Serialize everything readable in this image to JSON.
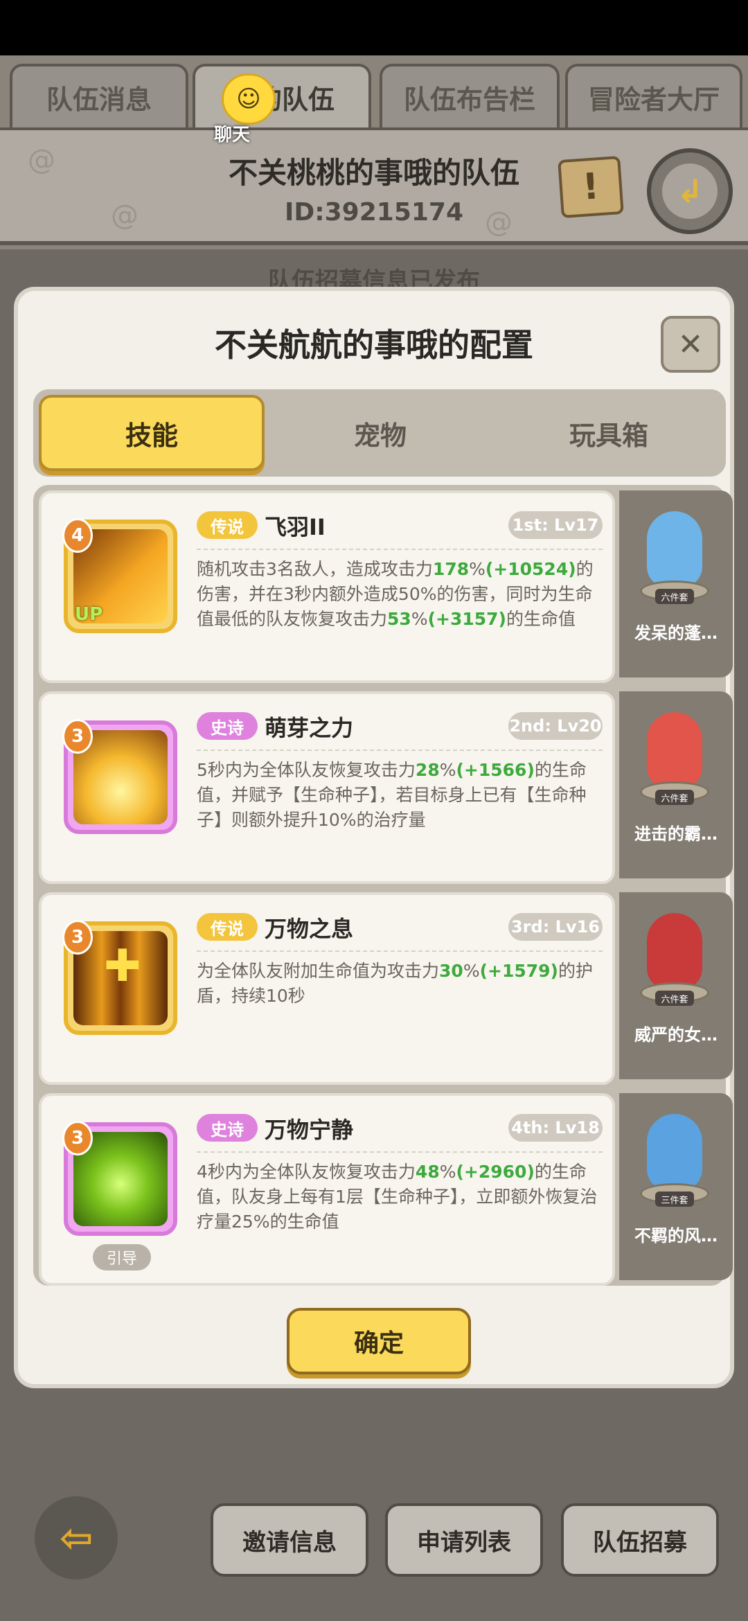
{
  "tabs": [
    "队伍消息",
    "我的队伍",
    "队伍布告栏",
    "冒险者大厅"
  ],
  "chat": {
    "label": "聊天"
  },
  "header": {
    "team_name": "不关桃桃的事哦的队伍",
    "team_id": "ID:39215174"
  },
  "background_notice": "队伍招募信息已发布",
  "modal": {
    "title": "不关航航的事哦的配置",
    "tabs": [
      "技能",
      "宠物",
      "玩具箱"
    ],
    "skills": [
      {
        "badge_level": "4",
        "rarity": "传说",
        "name": "飞羽II",
        "slot": "1st: Lv17",
        "up": "UP",
        "desc_parts": [
          "随机攻击3名敌人，造成攻击力",
          "178",
          "%",
          "(+10524)",
          "的伤害，并在3秒内额外造成50%的伤害，同时为生命值最低的队友恢复攻击力",
          "53",
          "%",
          "(+3157)",
          "的生命值"
        ]
      },
      {
        "badge_level": "3",
        "rarity": "史诗",
        "name": "萌芽之力",
        "slot": "2nd: Lv20",
        "desc_parts": [
          "5秒内为全体队友恢复攻击力",
          "28",
          "%",
          "(+1566)",
          "的生命值，并赋予【生命种子】，若目标身上已有【生命种子】则额外提升10%的治疗量"
        ]
      },
      {
        "badge_level": "3",
        "rarity": "传说",
        "name": "万物之息",
        "slot": "3rd: Lv16",
        "desc_parts": [
          "为全体队友附加生命值为攻击力",
          "30",
          "%",
          "(+1579)",
          "的护盾，持续10秒"
        ]
      },
      {
        "badge_level": "3",
        "rarity": "史诗",
        "name": "万物宁静",
        "slot": "4th: Lv18",
        "guide": "引导",
        "desc_parts": [
          "4秒内为全体队友恢复攻击力",
          "48",
          "%",
          "(+2960)",
          "的生命值，队友身上每有1层【生命种子】，立即额外恢复治疗量25%的生命值"
        ]
      }
    ],
    "pets": [
      {
        "name": "发呆的蓬…",
        "set": "六件套",
        "color": "#6fb4e8"
      },
      {
        "name": "进击的霸…",
        "set": "六件套",
        "color": "#e2554a"
      },
      {
        "name": "威严的女…",
        "set": "六件套",
        "color": "#c93a3a"
      },
      {
        "name": "不羁的风…",
        "set": "三件套",
        "color": "#5aa3e0"
      }
    ],
    "confirm": "确定"
  },
  "bottom": {
    "back_icon": "arrow-left-icon",
    "invite": "邀请信息",
    "applications": "申请列表",
    "recruit": "队伍招募"
  },
  "colors": {
    "accent": "#fbd95a",
    "legend": "#f3c53d",
    "epic": "#de82de",
    "highlight": "#3caa3c"
  }
}
